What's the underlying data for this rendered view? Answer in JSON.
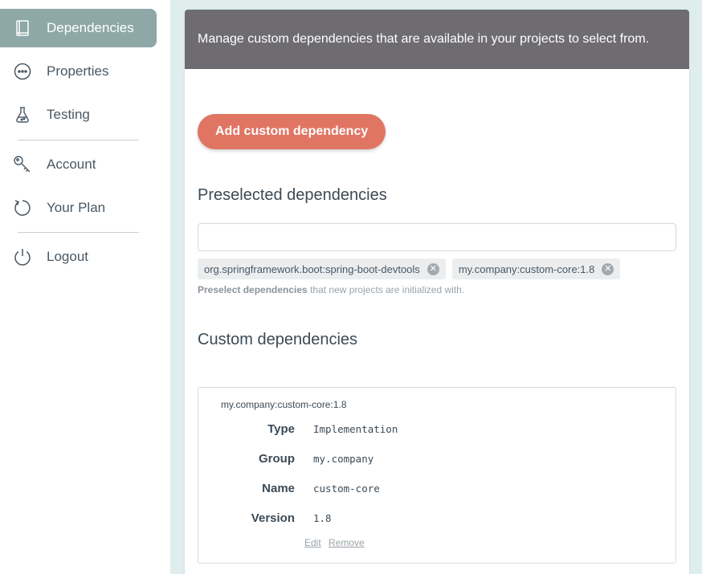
{
  "sidebar": {
    "items": [
      {
        "label": "Dependencies",
        "icon": "book-icon",
        "active": true
      },
      {
        "label": "Properties",
        "icon": "ellipsis-circle-icon"
      },
      {
        "label": "Testing",
        "icon": "flask-icon"
      },
      {
        "label": "Account",
        "icon": "key-icon"
      },
      {
        "label": "Your Plan",
        "icon": "refresh-icon"
      },
      {
        "label": "Logout",
        "icon": "power-icon"
      }
    ]
  },
  "header": {
    "description": "Manage custom dependencies that are available in your projects to select from."
  },
  "actions": {
    "add_label": "Add custom dependency"
  },
  "preselected": {
    "title": "Preselected dependencies",
    "input_value": "",
    "chips": [
      "org.springframework.boot:spring-boot-devtools",
      "my.company:custom-core:1.8"
    ],
    "help_bold": "Preselect dependencies",
    "help_rest": " that new projects are initialized with."
  },
  "custom": {
    "title": "Custom dependencies",
    "dependency": {
      "name": "my.company:custom-core:1.8",
      "fields": [
        {
          "label": "Type",
          "value": "Implementation"
        },
        {
          "label": "Group",
          "value": "my.company"
        },
        {
          "label": "Name",
          "value": "custom-core"
        },
        {
          "label": "Version",
          "value": "1.8"
        }
      ],
      "edit_label": "Edit",
      "remove_label": "Remove"
    }
  },
  "colors": {
    "accent": "#e07563",
    "sidebar_active": "#8da8a6",
    "header_bg": "#6e6c70"
  }
}
